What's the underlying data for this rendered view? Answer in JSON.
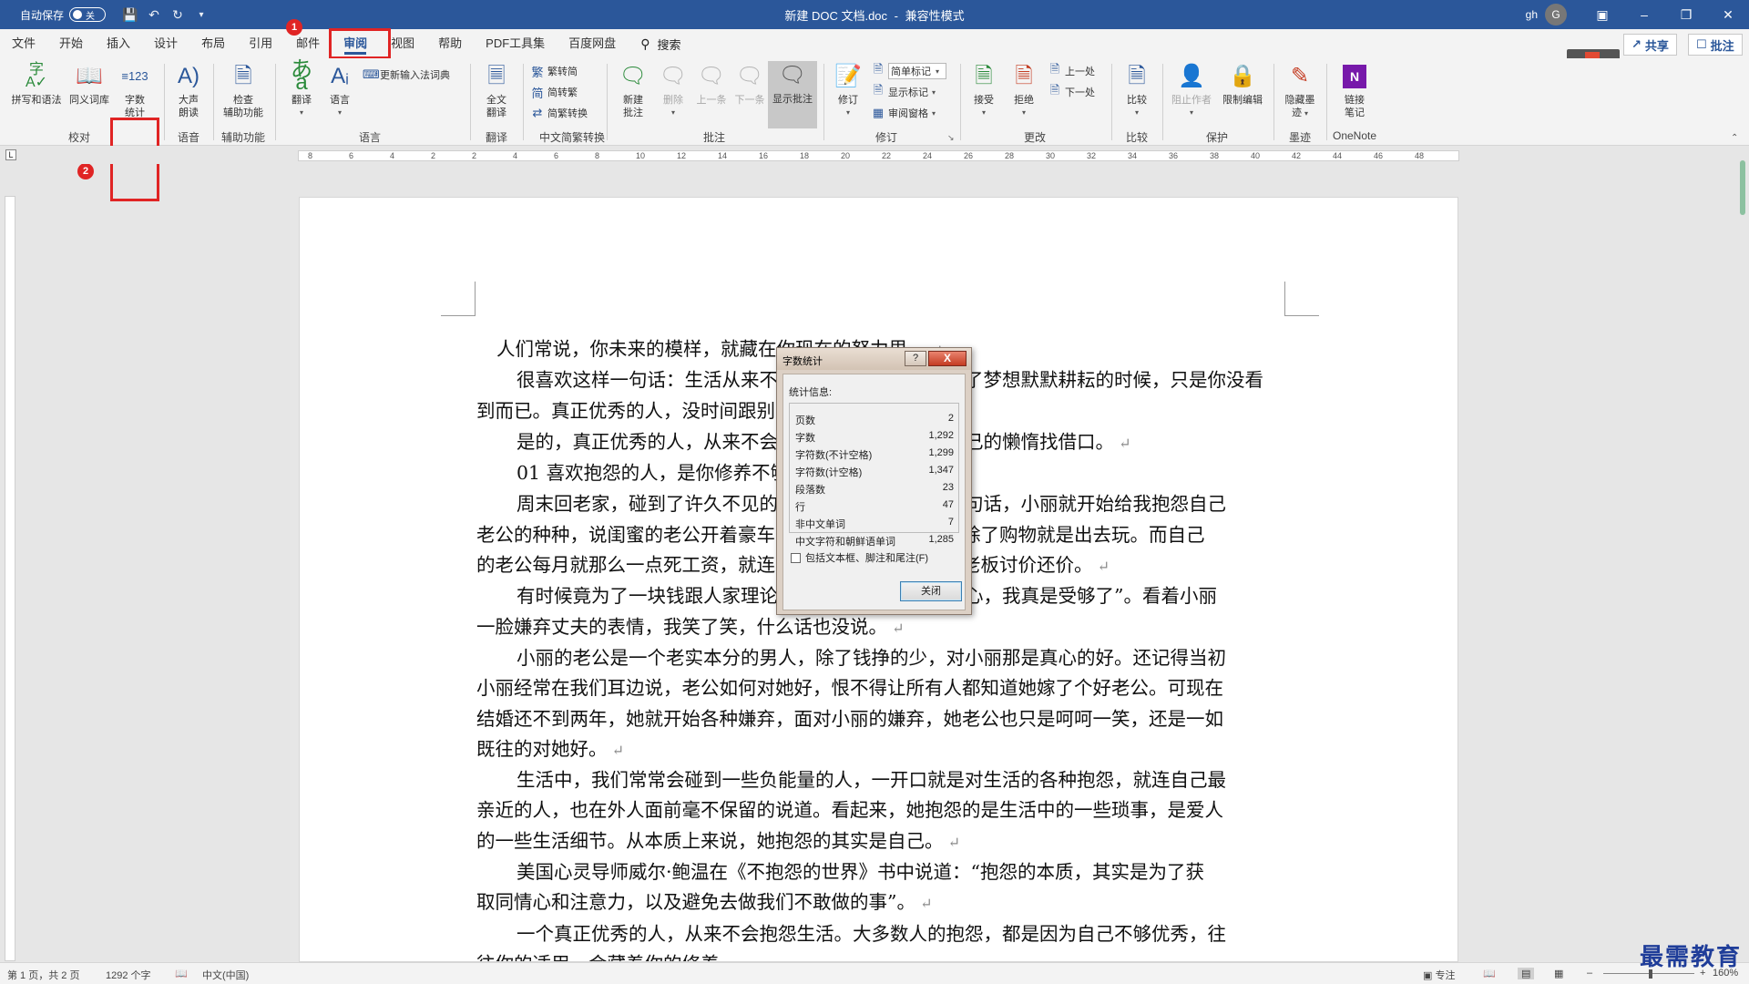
{
  "titlebar": {
    "autosave_label": "自动保存",
    "autosave_state": "关",
    "doc_title": "新建 DOC 文档.doc",
    "separator": "-",
    "mode": "兼容性模式",
    "user": "gh",
    "avatar": "G"
  },
  "tabs": [
    "文件",
    "开始",
    "插入",
    "设计",
    "布局",
    "引用",
    "邮件",
    "审阅",
    "视图",
    "帮助",
    "PDF工具集",
    "百度网盘"
  ],
  "active_tab": "审阅",
  "search_label": "搜索",
  "share_label": "共享",
  "comment_label": "批注",
  "annotations": {
    "badge1": "1",
    "badge2": "2"
  },
  "ribbon": {
    "spelling": "拼写和语法",
    "thesaurus": "同义词库",
    "wordcount_line1": "字数",
    "wordcount_line2": "统计",
    "read_aloud_line1": "大声",
    "read_aloud_line2": "朗读",
    "accessibility_line1": "检查",
    "accessibility_line2": "辅助功能",
    "translate": "翻译",
    "language": "语言",
    "update_ime": "更新输入法词典",
    "full_translate_line1": "全文",
    "full_translate_line2": "翻译",
    "to_traditional": "繁转简",
    "to_simplified": "简转繁",
    "convert": "简繁转换",
    "new_comment_line1": "新建",
    "new_comment_line2": "批注",
    "delete": "删除",
    "previous": "上一条",
    "next": "下一条",
    "show_comments": "显示批注",
    "track_changes": "修订",
    "simple_markup": "简单标记",
    "show_markup": "显示标记",
    "review_pane": "审阅窗格",
    "accept": "接受",
    "reject": "拒绝",
    "prev_change": "上一处",
    "next_change": "下一处",
    "compare": "比较",
    "block_authors": "阻止作者",
    "restrict_editing": "限制编辑",
    "hide_ink_line1": "隐藏墨",
    "hide_ink_line2": "迹",
    "linked_notes_line1": "链接",
    "linked_notes_line2": "笔记",
    "groups": {
      "proofing": "校对",
      "speech": "语音",
      "accessibility": "辅助功能",
      "language": "语言",
      "translate": "翻译",
      "chinese_conversion": "中文简繁转换",
      "comments": "批注",
      "tracking": "修订",
      "changes": "更改",
      "compare": "比较",
      "protect": "保护",
      "ink": "墨迹",
      "onenote": "OneNote"
    }
  },
  "ruler": {
    "ticks": [
      "8",
      "6",
      "4",
      "2",
      "2",
      "4",
      "6",
      "8",
      "10",
      "12",
      "14",
      "16",
      "18",
      "20",
      "22",
      "24",
      "26",
      "28",
      "30",
      "32",
      "34",
      "36",
      "38",
      "40",
      "42",
      "44",
      "46",
      "48"
    ]
  },
  "document": {
    "lines": [
      "人们常说，你未来的模样，就藏在你现在的努力里。",
      "很喜欢这样一句话：生活从来不会亏待任何人，当你为了梦想默默耕耘的时候，只是你没看",
      "到而已。真正优秀的人，没时间跟别人比较。",
      "是的，真正优秀的人，从来不会抱怨，也从来不会为自己的懒惰找借口。",
      "01  喜欢抱怨的人，是你修养不够",
      "周末回老家，碰到了许久不见的老同学小丽，寒暄了两句话，小丽就开始给我抱怨自己",
      "老公的种种，说闺蜜的老公开着豪车，闺蜜嫁给了老公每天除了购物就是出去玩。而自己",
      "的老公每月就那么一点死工资，就连买菜的时候还总跟菜贩老板讨价还价。",
      "有时候竟为了一块钱跟人家理论半天，说真的，对他阿心，我真是受够了”。看着小丽",
      "一脸嫌弃丈夫的表情，我笑了笑，什么话也没说。",
      "小丽的老公是一个老实本分的男人，除了钱挣的少，对小丽那是真心的好。还记得当初",
      "小丽经常在我们耳边说，老公如何对她好，恨不得让所有人都知道她嫁了个好老公。可现在",
      "结婚还不到两年，她就开始各种嫌弃，面对小丽的嫌弃，她老公也只是呵呵一笑，还是一如",
      "既往的对她好。",
      "生活中，我们常常会碰到一些负能量的人，一开口就是对生活的各种抱怨，就连自己最",
      "亲近的人，也在外人面前毫不保留的说道。看起来，她抱怨的是生活中的一些琐事，是爱人",
      "的一些生活细节。从本质上来说，她抱怨的其实是自己。",
      "美国心灵导师威尔·鲍温在《不抱怨的世界》书中说道：“抱怨的本质，其实是为了获",
      "取同情心和注意力，以及避免去做我们不敢做的事”。",
      "一个真正优秀的人，从来不会抱怨生活。大多数人的抱怨，都是因为自己不够优秀，往",
      "往你的适用，会藏着你的修养。"
    ]
  },
  "dialog": {
    "title": "字数统计",
    "help": "?",
    "close_x": "X",
    "heading": "统计信息:",
    "stats": [
      {
        "label": "页数",
        "value": "2"
      },
      {
        "label": "字数",
        "value": "1,292"
      },
      {
        "label": "字符数(不计空格)",
        "value": "1,299"
      },
      {
        "label": "字符数(计空格)",
        "value": "1,347"
      },
      {
        "label": "段落数",
        "value": "23"
      },
      {
        "label": "行",
        "value": "47"
      },
      {
        "label": "非中文单词",
        "value": "7"
      },
      {
        "label": "中文字符和朝鲜语单词",
        "value": "1,285"
      }
    ],
    "checkbox_label": "包括文本框、脚注和尾注(F)",
    "close_button": "关闭"
  },
  "statusbar": {
    "page": "第 1 页，共 2 页",
    "words": "1292 个字",
    "language": "中文(中国)",
    "focus": "专注",
    "zoom": "160%"
  },
  "watermark": "最需教育",
  "colors": {
    "brand": "#2b579a",
    "highlight": "#e02424"
  }
}
